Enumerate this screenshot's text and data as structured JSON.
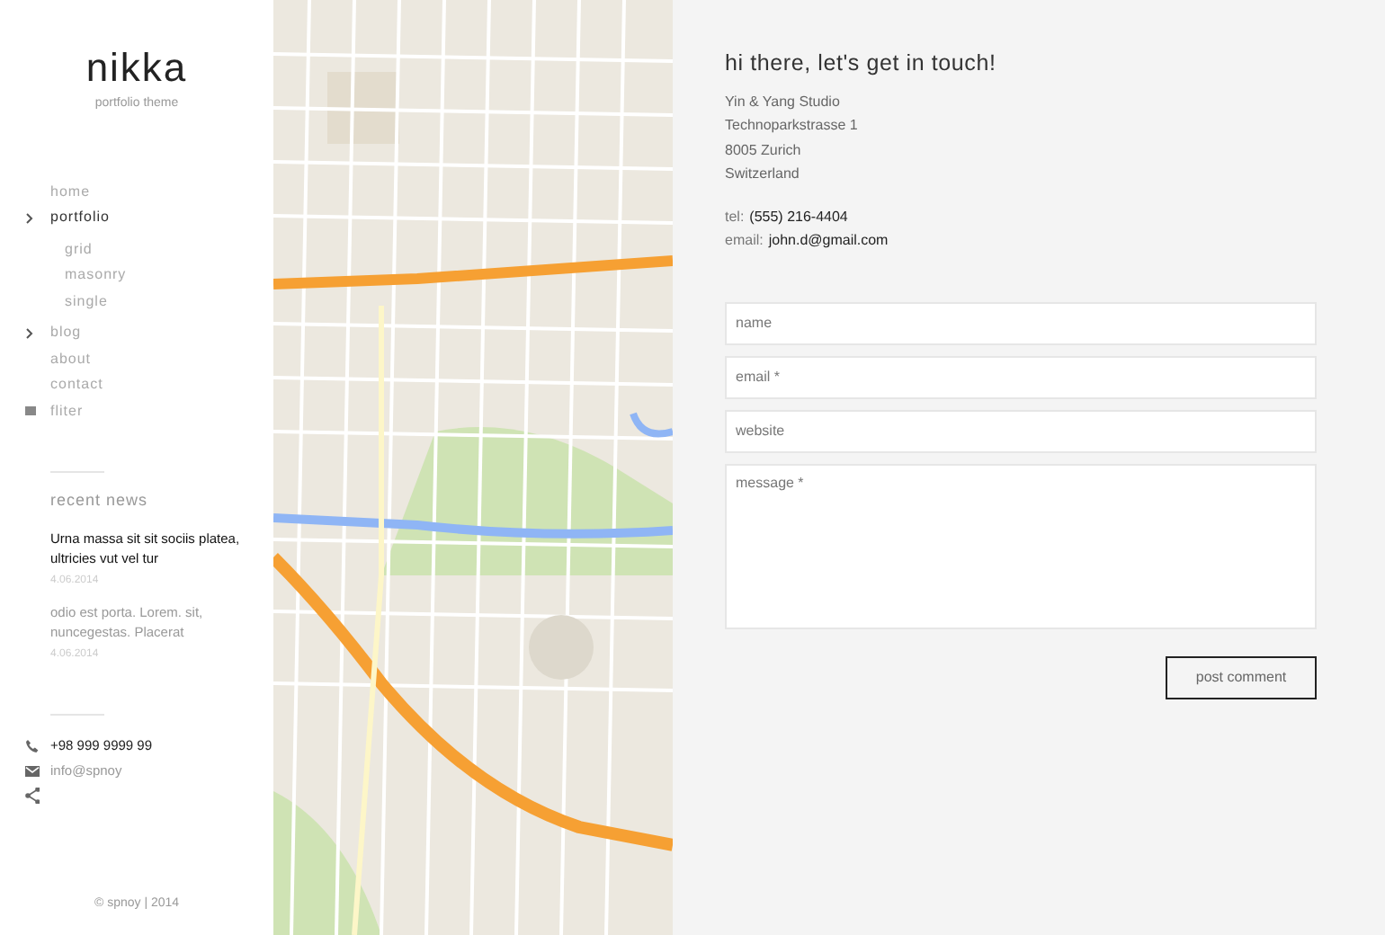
{
  "brand": {
    "logo": "nikka",
    "tagline": "portfolio theme"
  },
  "nav": [
    {
      "kind": "link",
      "label": "home",
      "selected": false
    },
    {
      "kind": "submenu",
      "label": "portfolio",
      "selected": true,
      "children": [
        {
          "label": "grid"
        },
        {
          "label": "masonry"
        },
        {
          "label": "single"
        }
      ]
    },
    {
      "kind": "submenu",
      "label": "blog",
      "selected": false
    },
    {
      "kind": "link",
      "label": "about",
      "selected": false
    },
    {
      "kind": "link",
      "label": "contact",
      "selected": false
    },
    {
      "kind": "filter",
      "label": "fliter",
      "selected": false
    }
  ],
  "recent_news": {
    "title": "recent news",
    "items": [
      {
        "headline": "Urna massa sit sit sociis platea, ultricies vut vel tur",
        "date": "4.06.2014",
        "highlighted": true
      },
      {
        "headline": "odio est porta. Lorem. sit, nuncegestas. Placerat",
        "date": "4.06.2014",
        "highlighted": false
      }
    ]
  },
  "sidebar_contact": [
    {
      "kind": "phone",
      "text": "+98 999 9999 99"
    },
    {
      "kind": "mail",
      "text": "info@spnoy"
    },
    {
      "kind": "share"
    }
  ],
  "footer": "© spnoy | 2014",
  "contact": {
    "heading": "hi there, let's get in touch!",
    "address": [
      "Yin & Yang Studio",
      "Technoparkstrasse 1",
      "8005 Zurich",
      "Switzerland"
    ],
    "details": [
      {
        "label": "tel:",
        "value": "(555) 216-4404"
      },
      {
        "label": "email:",
        "value": "john.d@gmail.com"
      }
    ],
    "form": [
      {
        "kind": "input",
        "placeholder": "name"
      },
      {
        "kind": "input",
        "placeholder": "email *"
      },
      {
        "kind": "input",
        "placeholder": "website"
      },
      {
        "kind": "textarea",
        "placeholder": "message *"
      }
    ],
    "submit": "post comment"
  }
}
